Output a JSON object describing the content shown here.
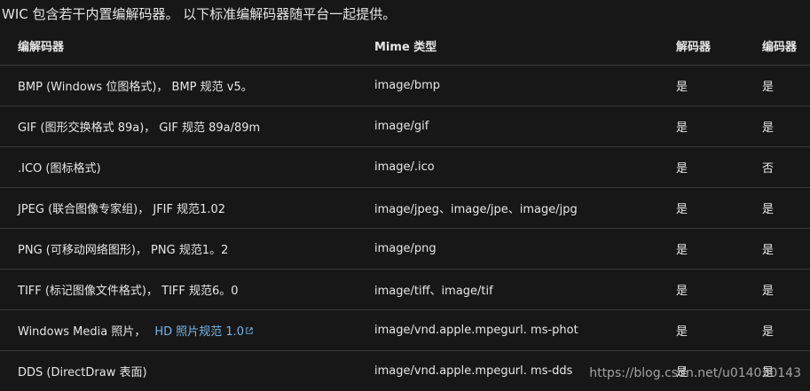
{
  "intro": "WIC 包含若干内置编解码器。 以下标准编解码器随平台一起提供。",
  "table": {
    "headers": [
      "编解码器",
      "Mime 类型",
      "解码器",
      "编码器"
    ],
    "rows": [
      {
        "codec": "BMP (Windows 位图格式)， BMP 规范 v5。",
        "mime": "image/bmp",
        "decoder": "是",
        "encoder": "是"
      },
      {
        "codec": "GIF (图形交换格式 89a)， GIF 规范 89a/89m",
        "mime": "image/gif",
        "decoder": "是",
        "encoder": "是"
      },
      {
        "codec": ".ICO (图标格式)",
        "mime": "image/.ico",
        "decoder": "是",
        "encoder": "否"
      },
      {
        "codec": "JPEG (联合图像专家组)， JFIF 规范1.02",
        "mime": "image/jpeg、image/jpe、image/jpg",
        "decoder": "是",
        "encoder": "是"
      },
      {
        "codec": "PNG (可移动网络图形)， PNG 规范1。2",
        "mime": "image/png",
        "decoder": "是",
        "encoder": "是"
      },
      {
        "codec": "TIFF (标记图像文件格式)， TIFF 规范6。0",
        "mime": "image/tiff、image/tif",
        "decoder": "是",
        "encoder": "是"
      },
      {
        "codec": "Windows Media 照片，",
        "codec_link": "HD 照片规范 1.0",
        "mime": "image/vnd.apple.mpegurl. ms-phot",
        "decoder": "是",
        "encoder": "是"
      },
      {
        "codec": "DDS (DirectDraw 表面)",
        "mime": "image/vnd.apple.mpegurl. ms-dds",
        "decoder": "是",
        "encoder": "是"
      }
    ]
  },
  "watermark": "https://blog.csdn.net/u014030143",
  "colors": {
    "background": "#171717",
    "text": "#e6e6e6",
    "link": "#75b6e7",
    "divider": "#3b3b3b"
  },
  "icons": {
    "external_link": "external-link-icon"
  }
}
